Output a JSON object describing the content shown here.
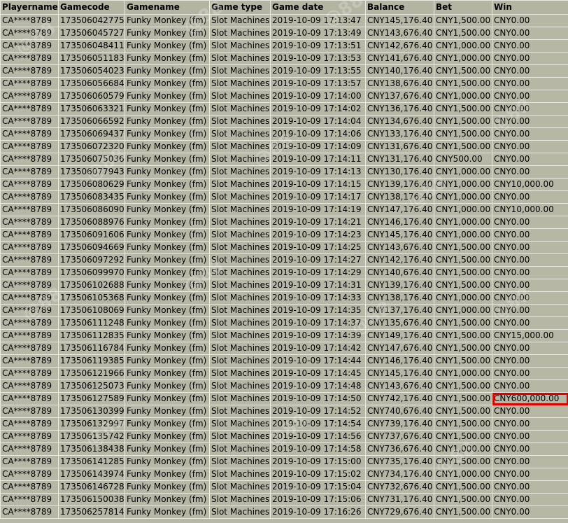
{
  "columns": [
    "Playername",
    "Gamecode",
    "Gamename",
    "Game type",
    "Game date",
    "Balance",
    "Bet",
    "Win"
  ],
  "rows": [
    [
      "CA****8789",
      "173506042775",
      "Funky Monkey (fm)",
      "Slot Machines",
      "2019-10-09 17:13:47",
      "CNY145,176.40",
      "CNY1,500.00",
      "CNY0.00"
    ],
    [
      "CA****8789",
      "173506045727",
      "Funky Monkey (fm)",
      "Slot Machines",
      "2019-10-09 17:13:49",
      "CNY143,676.40",
      "CNY1,500.00",
      "CNY0.00"
    ],
    [
      "CA****8789",
      "173506048411",
      "Funky Monkey (fm)",
      "Slot Machines",
      "2019-10-09 17:13:51",
      "CNY142,676.40",
      "CNY1,000.00",
      "CNY0.00"
    ],
    [
      "CA****8789",
      "173506051183",
      "Funky Monkey (fm)",
      "Slot Machines",
      "2019-10-09 17:13:53",
      "CNY141,676.40",
      "CNY1,000.00",
      "CNY0.00"
    ],
    [
      "CA****8789",
      "173506054023",
      "Funky Monkey (fm)",
      "Slot Machines",
      "2019-10-09 17:13:55",
      "CNY140,176.40",
      "CNY1,500.00",
      "CNY0.00"
    ],
    [
      "CA****8789",
      "173506056684",
      "Funky Monkey (fm)",
      "Slot Machines",
      "2019-10-09 17:13:57",
      "CNY138,676.40",
      "CNY1,500.00",
      "CNY0.00"
    ],
    [
      "CA****8789",
      "173506060579",
      "Funky Monkey (fm)",
      "Slot Machines",
      "2019-10-09 17:14:00",
      "CNY137,676.40",
      "CNY1,000.00",
      "CNY0.00"
    ],
    [
      "CA****8789",
      "173506063321",
      "Funky Monkey (fm)",
      "Slot Machines",
      "2019-10-09 17:14:02",
      "CNY136,176.40",
      "CNY1,500.00",
      "CNY0.00"
    ],
    [
      "CA****8789",
      "173506066592",
      "Funky Monkey (fm)",
      "Slot Machines",
      "2019-10-09 17:14:04",
      "CNY134,676.40",
      "CNY1,500.00",
      "CNY0.00"
    ],
    [
      "CA****8789",
      "173506069437",
      "Funky Monkey (fm)",
      "Slot Machines",
      "2019-10-09 17:14:06",
      "CNY133,176.40",
      "CNY1,500.00",
      "CNY0.00"
    ],
    [
      "CA****8789",
      "173506072320",
      "Funky Monkey (fm)",
      "Slot Machines",
      "2019-10-09 17:14:09",
      "CNY131,676.40",
      "CNY1,500.00",
      "CNY0.00"
    ],
    [
      "CA****8789",
      "173506075036",
      "Funky Monkey (fm)",
      "Slot Machines",
      "2019-10-09 17:14:11",
      "CNY131,176.40",
      "CNY500.00",
      "CNY0.00"
    ],
    [
      "CA****8789",
      "173506077943",
      "Funky Monkey (fm)",
      "Slot Machines",
      "2019-10-09 17:14:13",
      "CNY130,176.40",
      "CNY1,000.00",
      "CNY0.00"
    ],
    [
      "CA****8789",
      "173506080629",
      "Funky Monkey (fm)",
      "Slot Machines",
      "2019-10-09 17:14:15",
      "CNY139,176.40",
      "CNY1,000.00",
      "CNY10,000.00"
    ],
    [
      "CA****8789",
      "173506083435",
      "Funky Monkey (fm)",
      "Slot Machines",
      "2019-10-09 17:14:17",
      "CNY138,176.40",
      "CNY1,000.00",
      "CNY0.00"
    ],
    [
      "CA****8789",
      "173506086090",
      "Funky Monkey (fm)",
      "Slot Machines",
      "2019-10-09 17:14:19",
      "CNY147,176.40",
      "CNY1,000.00",
      "CNY10,000.00"
    ],
    [
      "CA****8789",
      "173506088976",
      "Funky Monkey (fm)",
      "Slot Machines",
      "2019-10-09 17:14:21",
      "CNY146,176.40",
      "CNY1,000.00",
      "CNY0.00"
    ],
    [
      "CA****8789",
      "173506091606",
      "Funky Monkey (fm)",
      "Slot Machines",
      "2019-10-09 17:14:23",
      "CNY145,176.40",
      "CNY1,000.00",
      "CNY0.00"
    ],
    [
      "CA****8789",
      "173506094669",
      "Funky Monkey (fm)",
      "Slot Machines",
      "2019-10-09 17:14:25",
      "CNY143,676.40",
      "CNY1,500.00",
      "CNY0.00"
    ],
    [
      "CA****8789",
      "173506097292",
      "Funky Monkey (fm)",
      "Slot Machines",
      "2019-10-09 17:14:27",
      "CNY142,176.40",
      "CNY1,500.00",
      "CNY0.00"
    ],
    [
      "CA****8789",
      "173506099970",
      "Funky Monkey (fm)",
      "Slot Machines",
      "2019-10-09 17:14:29",
      "CNY140,676.40",
      "CNY1,500.00",
      "CNY0.00"
    ],
    [
      "CA****8789",
      "173506102688",
      "Funky Monkey (fm)",
      "Slot Machines",
      "2019-10-09 17:14:31",
      "CNY139,176.40",
      "CNY1,500.00",
      "CNY0.00"
    ],
    [
      "CA****8789",
      "173506105368",
      "Funky Monkey (fm)",
      "Slot Machines",
      "2019-10-09 17:14:33",
      "CNY138,176.40",
      "CNY1,000.00",
      "CNY0.00"
    ],
    [
      "CA****8789",
      "173506108069",
      "Funky Monkey (fm)",
      "Slot Machines",
      "2019-10-09 17:14:35",
      "CNY137,176.40",
      "CNY1,000.00",
      "CNY0.00"
    ],
    [
      "CA****8789",
      "173506111248",
      "Funky Monkey (fm)",
      "Slot Machines",
      "2019-10-09 17:14:37",
      "CNY135,676.40",
      "CNY1,500.00",
      "CNY0.00"
    ],
    [
      "CA****8789",
      "173506112835",
      "Funky Monkey (fm)",
      "Slot Machines",
      "2019-10-09 17:14:39",
      "CNY149,176.40",
      "CNY1,500.00",
      "CNY15,000.00"
    ],
    [
      "CA****8789",
      "173506116784",
      "Funky Monkey (fm)",
      "Slot Machines",
      "2019-10-09 17:14:42",
      "CNY147,676.40",
      "CNY1,500.00",
      "CNY0.00"
    ],
    [
      "CA****8789",
      "173506119385",
      "Funky Monkey (fm)",
      "Slot Machines",
      "2019-10-09 17:14:44",
      "CNY146,176.40",
      "CNY1,500.00",
      "CNY0.00"
    ],
    [
      "CA****8789",
      "173506121966",
      "Funky Monkey (fm)",
      "Slot Machines",
      "2019-10-09 17:14:45",
      "CNY145,176.40",
      "CNY1,000.00",
      "CNY0.00"
    ],
    [
      "CA****8789",
      "173506125073",
      "Funky Monkey (fm)",
      "Slot Machines",
      "2019-10-09 17:14:48",
      "CNY143,676.40",
      "CNY1,500.00",
      "CNY0.00"
    ],
    [
      "CA****8789",
      "173506127589",
      "Funky Monkey (fm)",
      "Slot Machines",
      "2019-10-09 17:14:50",
      "CNY742,176.40",
      "CNY1,500.00",
      "CNY600,000.00"
    ],
    [
      "CA****8789",
      "173506130399",
      "Funky Monkey (fm)",
      "Slot Machines",
      "2019-10-09 17:14:52",
      "CNY740,676.40",
      "CNY1,500.00",
      "CNY0.00"
    ],
    [
      "CA****8789",
      "173506132997",
      "Funky Monkey (fm)",
      "Slot Machines",
      "2019-10-09 17:14:54",
      "CNY739,176.40",
      "CNY1,500.00",
      "CNY0.00"
    ],
    [
      "CA****8789",
      "173506135742",
      "Funky Monkey (fm)",
      "Slot Machines",
      "2019-10-09 17:14:56",
      "CNY737,676.40",
      "CNY1,500.00",
      "CNY0.00"
    ],
    [
      "CA****8789",
      "173506138438",
      "Funky Monkey (fm)",
      "Slot Machines",
      "2019-10-09 17:14:58",
      "CNY736,676.40",
      "CNY1,000.00",
      "CNY0.00"
    ],
    [
      "CA****8789",
      "173506141285",
      "Funky Monkey (fm)",
      "Slot Machines",
      "2019-10-09 17:15:00",
      "CNY735,176.40",
      "CNY1,500.00",
      "CNY0.00"
    ],
    [
      "CA****8789",
      "173506143974",
      "Funky Monkey (fm)",
      "Slot Machines",
      "2019-10-09 17:15:02",
      "CNY734,176.40",
      "CNY1,000.00",
      "CNY0.00"
    ],
    [
      "CA****8789",
      "173506146728",
      "Funky Monkey (fm)",
      "Slot Machines",
      "2019-10-09 17:15:04",
      "CNY732,676.40",
      "CNY1,500.00",
      "CNY0.00"
    ],
    [
      "CA****8789",
      "173506150038",
      "Funky Monkey (fm)",
      "Slot Machines",
      "2019-10-09 17:15:06",
      "CNY731,176.40",
      "CNY1,500.00",
      "CNY0.00"
    ],
    [
      "CA****8789",
      "173506257814",
      "Funky Monkey (fm)",
      "Slot Machines",
      "2019-10-09 17:16:26",
      "CNY729,676.40",
      "CNY1,500.00",
      "CNY0.00"
    ]
  ],
  "highlight": {
    "row": 30,
    "column": 7,
    "color": "#e00000"
  },
  "colors": {
    "background": "#b7b7a6",
    "grid": "#e9e9df"
  },
  "watermark": "@88"
}
